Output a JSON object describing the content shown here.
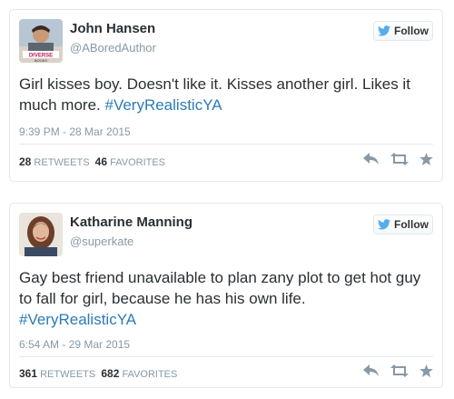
{
  "tweets": [
    {
      "name": "John Hansen",
      "handle": "@ABoredAuthor",
      "follow_label": "Follow",
      "text_main": "Girl kisses boy. Doesn't like it. Kisses another girl. Likes it much more. ",
      "hashtag": "#VeryRealisticYA",
      "time": "9:39 PM - 28 Mar 2015",
      "retweets": "28",
      "retweets_label": "RETWEETS",
      "favorites": "46",
      "favorites_label": "FAVORITES",
      "avatar_text": "DIVERSE BOOKS"
    },
    {
      "name": "Katharine Manning",
      "handle": "@superkate",
      "follow_label": "Follow",
      "text_main": "Gay best friend unavailable to plan zany plot to get hot guy to fall for girl, because he has his own life.",
      "hashtag": "#VeryRealisticYA",
      "time": "6:54 AM - 29 Mar 2015",
      "retweets": "361",
      "retweets_label": "RETWEETS",
      "favorites": "682",
      "favorites_label": "FAVORITES"
    }
  ],
  "colors": {
    "link": "#2b7bb9",
    "twitter_blue": "#55acee",
    "muted": "#8899a6",
    "text": "#292f33"
  },
  "icons": [
    "twitter-bird-icon",
    "reply-icon",
    "retweet-icon",
    "favorite-icon"
  ]
}
